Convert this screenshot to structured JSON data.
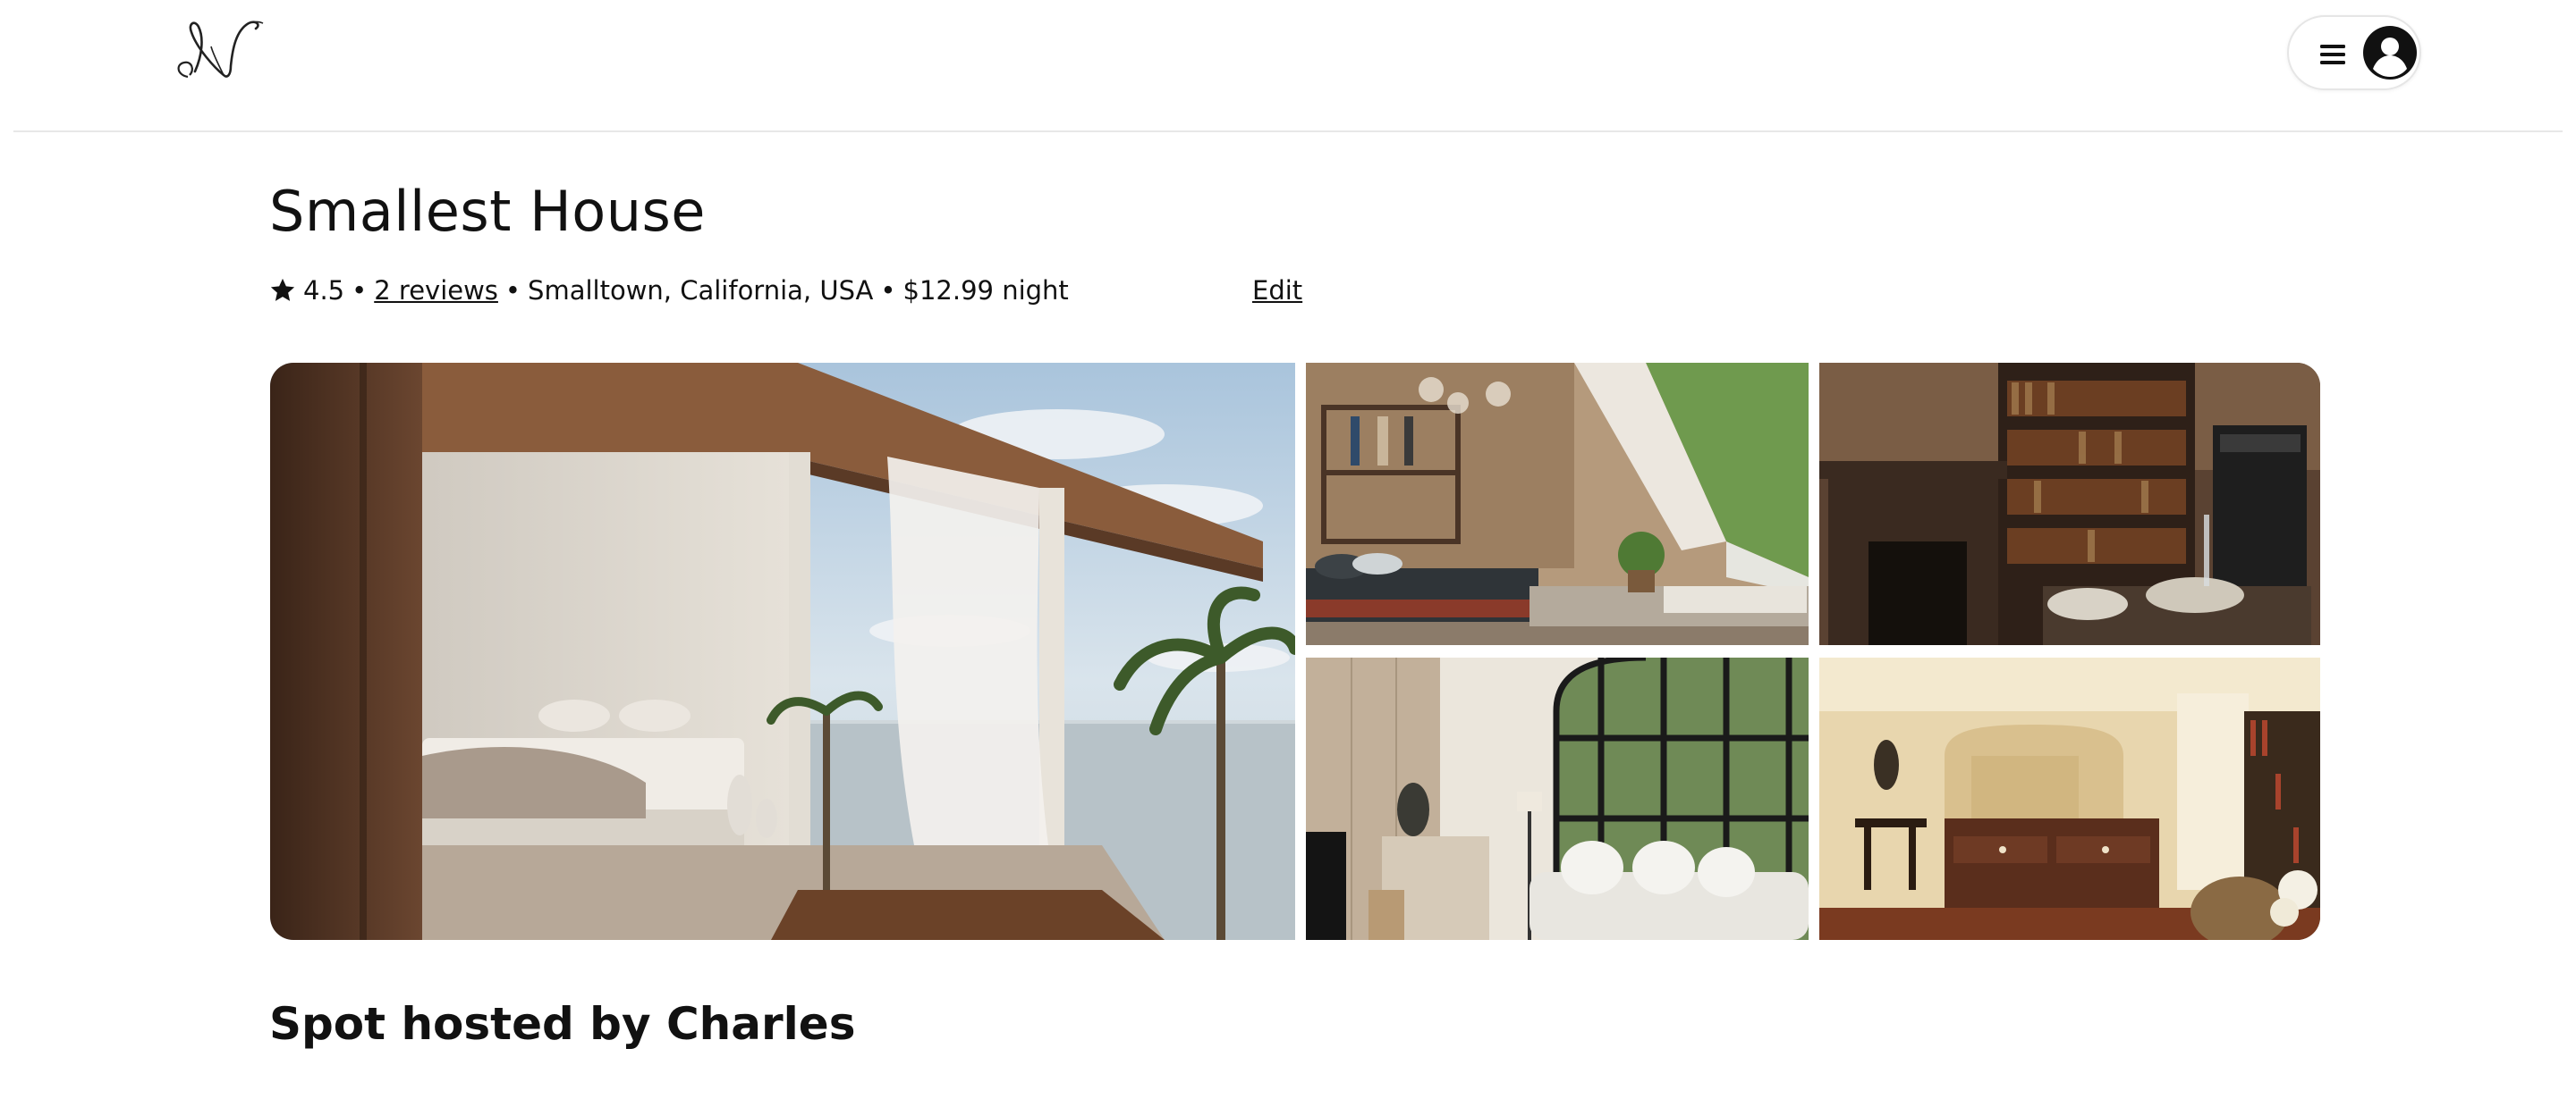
{
  "header": {
    "logo_icon": "script-n-logo",
    "menu_icon": "hamburger-icon",
    "avatar_icon": "user-circle-icon"
  },
  "listing": {
    "title": "Smallest House",
    "rating": "4.5",
    "separator": "•",
    "reviews_label": "2 reviews",
    "location": "Smalltown, California, USA",
    "price": "$12.99 night",
    "edit_label": "Edit"
  },
  "gallery": {
    "photos": [
      {
        "name": "open-air-bedroom-photo"
      },
      {
        "name": "loft-bedroom-photo"
      },
      {
        "name": "library-fireplace-photo"
      },
      {
        "name": "living-room-photo"
      },
      {
        "name": "kitchen-photo"
      }
    ]
  },
  "host": {
    "heading": "Spot hosted by Charles"
  },
  "colors": {
    "text": "#111111",
    "divider": "#e8e8e8",
    "pill_border": "#e6e6e6"
  }
}
